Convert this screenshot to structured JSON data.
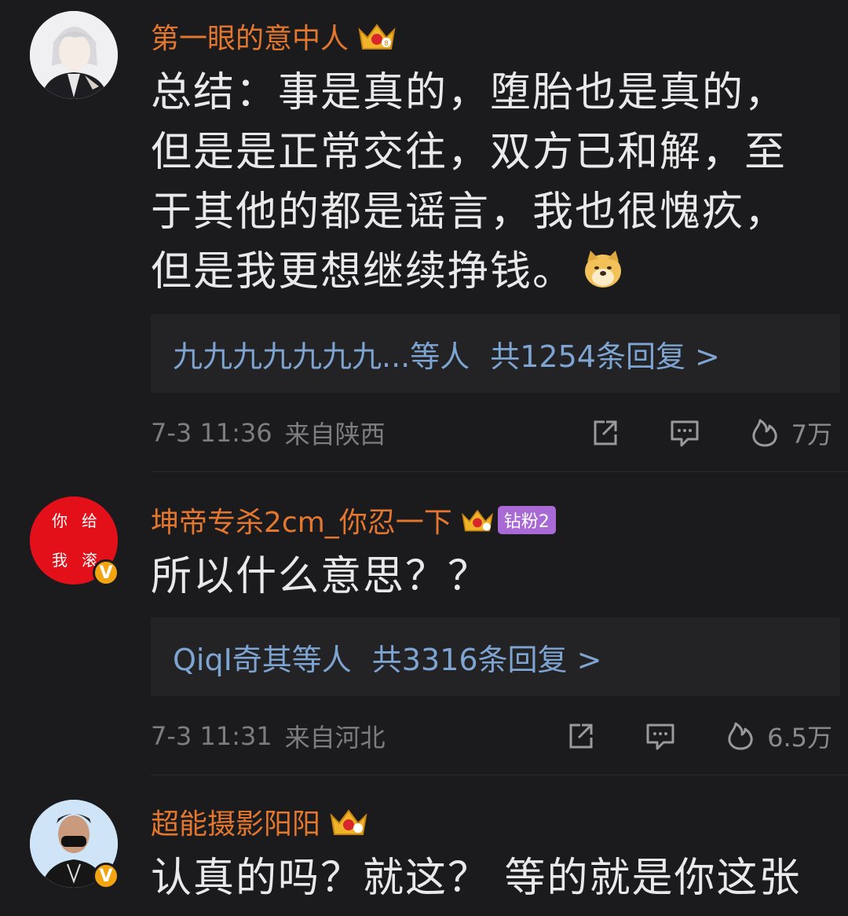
{
  "comments": [
    {
      "username": "第一眼的意中人",
      "content_lines": [
        "总结：事是真的，堕胎也是真的，",
        "但是是正常交往，双方已和解，至",
        "于其他的都是谣言，我也很愧疚，",
        "但是我更想继续挣钱。"
      ],
      "reply_names": "九九九九九九九...等人",
      "reply_count": "共1254条回复 >",
      "time": "7-3 11:36",
      "location": "来自陕西",
      "likes": "7万"
    },
    {
      "username": "坤帝专杀2cm_你忍一下",
      "fan_badge": "钻粉2",
      "avatar_chars": [
        "你",
        "给",
        "我",
        "滚"
      ],
      "content_lines": [
        "所以什么意思？？"
      ],
      "reply_names": "QiqI奇其等人",
      "reply_count": "共3316条回复 >",
      "time": "7-3 11:31",
      "location": "来自河北",
      "likes": "6.5万"
    },
    {
      "username": "超能摄影阳阳",
      "content_lines": [
        "认真的吗？就这？ 等的就是你这张"
      ]
    }
  ],
  "colors": {
    "background": "#1b1b1d",
    "username": "#e4772f",
    "reply_link": "#7ea4d2",
    "meta": "#7d7d7d",
    "verified": "#f2a511"
  },
  "icons": [
    "share-icon",
    "comment-icon",
    "like-flame-icon",
    "crown-badge-icon",
    "doge-emoji-icon",
    "verified-badge-icon"
  ]
}
